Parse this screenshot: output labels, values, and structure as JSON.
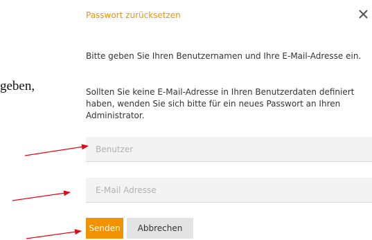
{
  "background_text": "geben,",
  "dialog": {
    "title": "Passwort zurücksetzen",
    "close_icon": "close-icon",
    "paragraph_1": "Bitte geben Sie Ihren Benutzernamen und Ihre E-Mail-Adresse ein.",
    "paragraph_2": "Sollten Sie keine E-Mail-Adresse in Ihren Benutzerdaten definiert haben, wenden Sie sich bitte für ein neues Passwort an Ihren Administrator.",
    "username_placeholder": "Benutzer",
    "username_value": "",
    "email_placeholder": "E-Mail Adresse",
    "email_value": "",
    "send_label": "Senden",
    "cancel_label": "Abbrechen"
  },
  "annotations": {
    "arrow_icon": "red-arrow-icon",
    "arrow_count": 3
  },
  "colors": {
    "accent": "#f39200",
    "arrow": "#e30613",
    "field_bg": "#f3f3f3",
    "cancel_bg": "#e3e3e3"
  }
}
